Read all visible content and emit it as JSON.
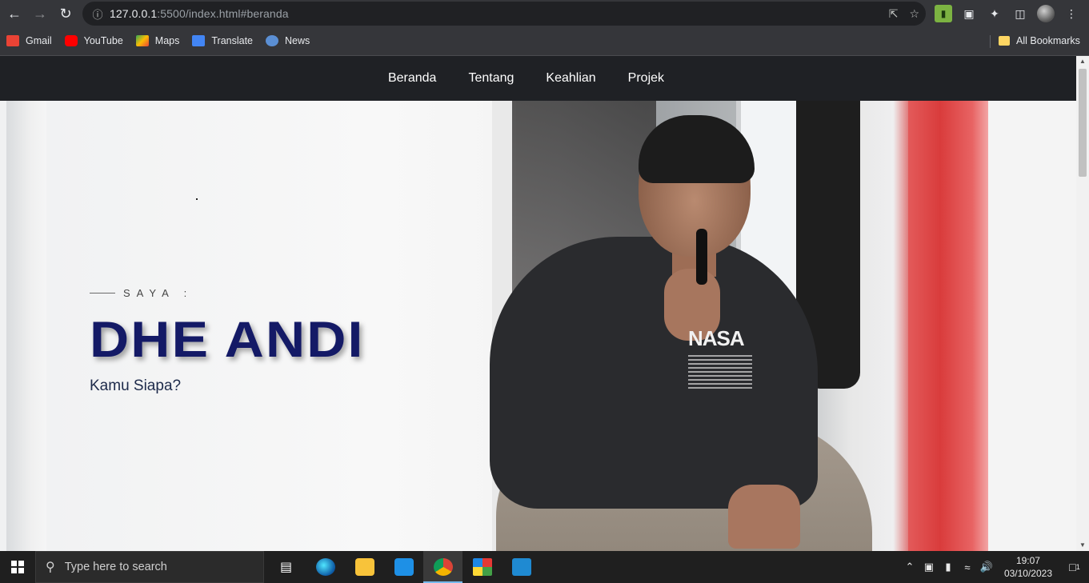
{
  "browser": {
    "url_host": "127.0.0.1",
    "url_rest": ":5500/index.html#beranda",
    "bookmarks": [
      {
        "label": "Gmail",
        "color": "#ea4335"
      },
      {
        "label": "YouTube",
        "color": "#ff0000"
      },
      {
        "label": "Maps",
        "color": "#34a853"
      },
      {
        "label": "Translate",
        "color": "#4285f4"
      },
      {
        "label": "News",
        "color": "#5b8fd4"
      }
    ],
    "all_bookmarks": "All Bookmarks"
  },
  "site": {
    "nav": [
      "Beranda",
      "Tentang",
      "Keahlian",
      "Projek"
    ],
    "hero": {
      "eyebrow": "SAYA :",
      "name": "DHE ANDI",
      "subtitle": "Kamu Siapa?"
    },
    "colors": {
      "navbar": "#1f2125",
      "name": "#141a66"
    }
  },
  "taskbar": {
    "search_placeholder": "Type here to search",
    "time": "19:07",
    "date": "03/10/2023",
    "notification_count": "1"
  }
}
